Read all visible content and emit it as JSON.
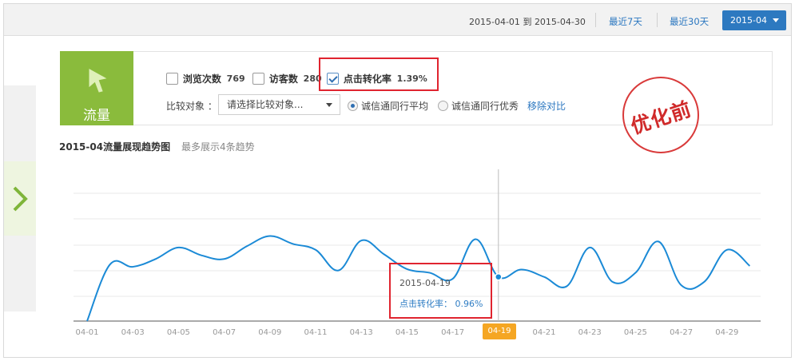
{
  "header": {
    "date_from": "2015-04-01",
    "date_to_word": "到",
    "date_to": "2015-04-30",
    "quick_7": "最近7天",
    "quick_30": "最近30天",
    "month_select": "2015-04"
  },
  "category": {
    "title": "流量"
  },
  "metrics": [
    {
      "label": "浏览次数",
      "value": "769",
      "checked": false
    },
    {
      "label": "访客数",
      "value": "280",
      "checked": false
    },
    {
      "label": "点击转化率",
      "value": "1.39%",
      "checked": true
    }
  ],
  "compare": {
    "label": "比较对象 ：",
    "select_placeholder": "请选择比较对象...",
    "options": [
      "诚信通同行平均",
      "诚信通同行优秀"
    ],
    "selected": "诚信通同行平均",
    "remove_link": "移除对比"
  },
  "stamp": {
    "text": "优化前"
  },
  "chart_section": {
    "title": "2015-04流量展现趋势图",
    "subtitle": "最多展示4条趋势"
  },
  "tooltip": {
    "date": "2015-04-19",
    "text": "点击转化率： 0.96%"
  },
  "colors": {
    "brand_green": "#8abb3c",
    "accent_blue": "#2d79c0",
    "highlight_red": "#e0242f",
    "line_blue": "#1b8ad6",
    "x_badge": "#f5a623"
  },
  "chart_data": {
    "type": "line",
    "x": [
      "04-01",
      "04-02",
      "04-03",
      "04-04",
      "04-05",
      "04-06",
      "04-07",
      "04-08",
      "04-09",
      "04-10",
      "04-11",
      "04-12",
      "04-13",
      "04-14",
      "04-15",
      "04-16",
      "04-17",
      "04-18",
      "04-19",
      "04-20",
      "04-21",
      "04-22",
      "04-23",
      "04-24",
      "04-25",
      "04-26",
      "04-27",
      "04-28",
      "04-29",
      "04-30"
    ],
    "x_ticks": [
      "04-01",
      "04-03",
      "04-05",
      "04-07",
      "04-09",
      "04-11",
      "04-13",
      "04-15",
      "04-17",
      "04-19",
      "04-21",
      "04-23",
      "04-25",
      "04-27",
      "04-29"
    ],
    "series": [
      {
        "name": "点击转化率",
        "values": [
          0.0,
          1.23,
          1.18,
          1.35,
          1.6,
          1.43,
          1.35,
          1.63,
          1.85,
          1.68,
          1.55,
          1.1,
          1.75,
          1.45,
          1.13,
          1.05,
          0.92,
          1.78,
          0.96,
          1.12,
          0.96,
          0.76,
          1.6,
          0.85,
          1.05,
          1.73,
          0.78,
          0.85,
          1.55,
          1.2
        ]
      }
    ],
    "highlight_index": 18,
    "ylim": [
      0,
      3.3
    ],
    "grid": true,
    "legend": "none"
  }
}
